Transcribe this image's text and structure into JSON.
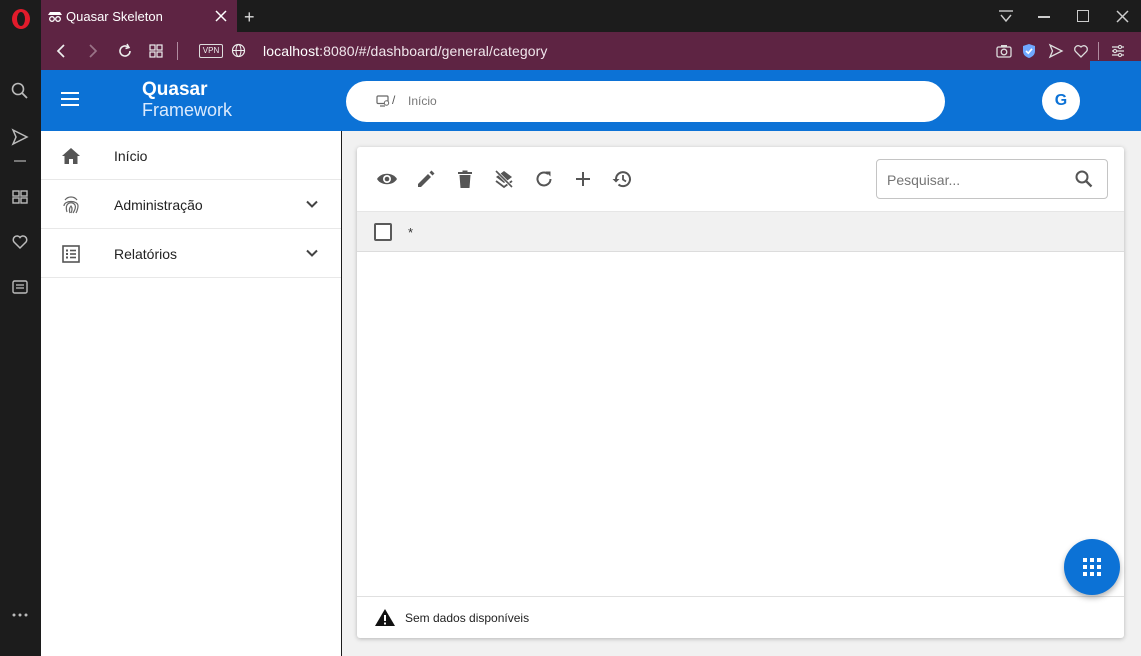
{
  "browser": {
    "tab_title": "Quasar Skeleton",
    "new_tab_label": "+",
    "vpn_label": "VPN",
    "url_host": "localhost",
    "url_rest": ":8080/#/dashboard/general/category"
  },
  "header": {
    "logo_line1": "Quasar",
    "logo_line2": "Framework",
    "breadcrumb_sep": "/",
    "breadcrumb_current": "Início",
    "avatar_initial": "G"
  },
  "sidebar": {
    "items": [
      {
        "label": "Início",
        "icon": "home-icon"
      },
      {
        "label": "Administração",
        "icon": "fingerprint-icon"
      },
      {
        "label": "Relatórios",
        "icon": "list-icon"
      }
    ]
  },
  "table": {
    "search_placeholder": "Pesquisar...",
    "header_col": "*",
    "no_data": "Sem dados disponíveis"
  },
  "colors": {
    "primary": "#0c72d6",
    "browser_bar": "#5e2443"
  }
}
